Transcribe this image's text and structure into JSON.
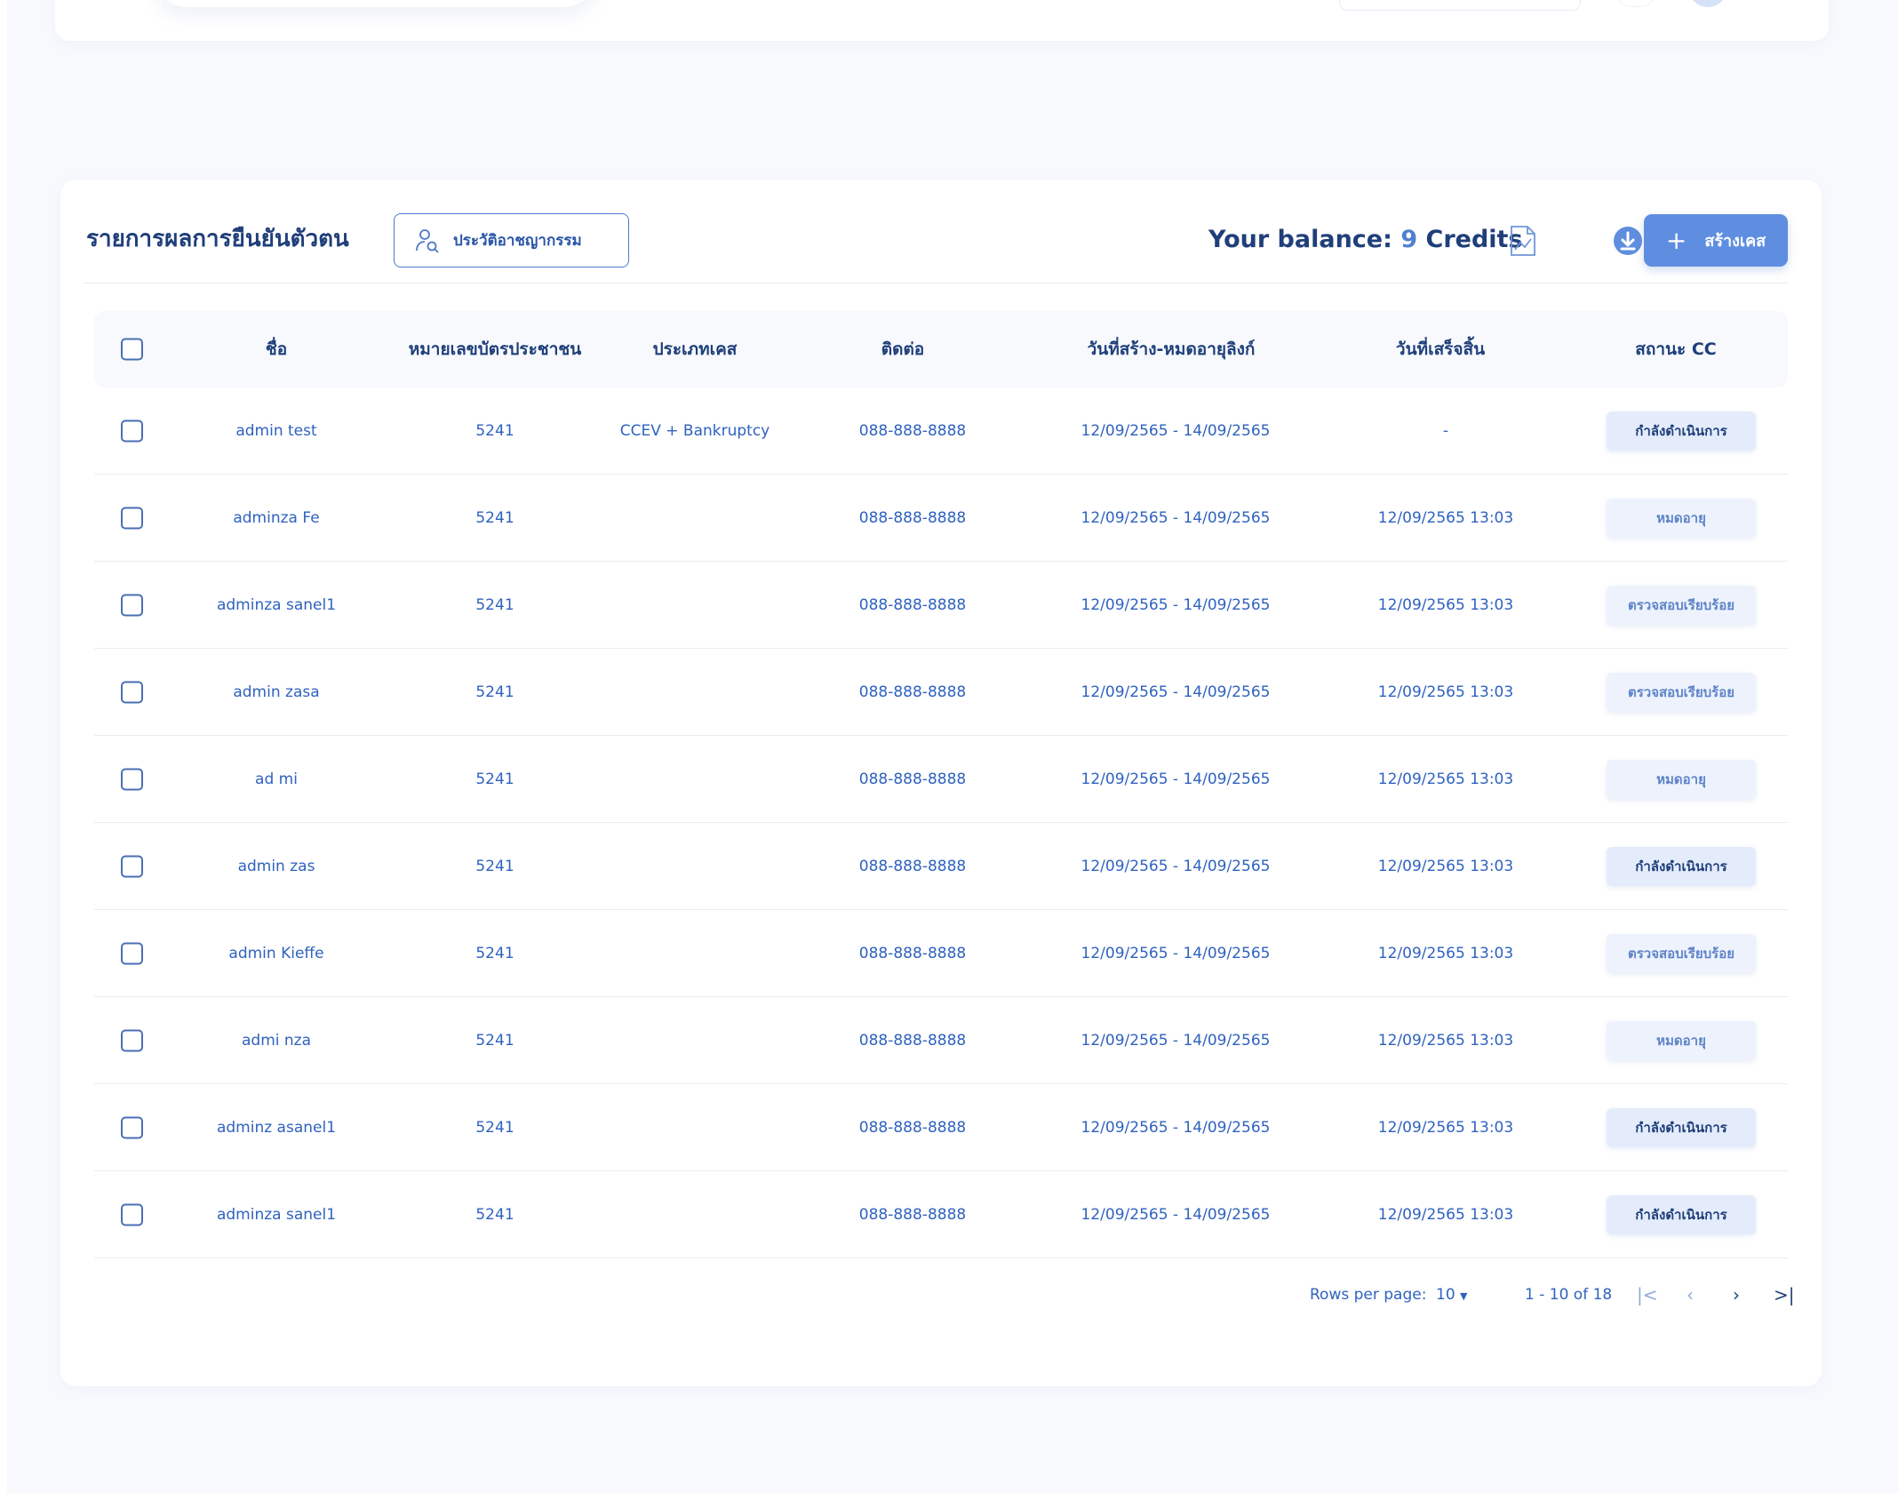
{
  "page": {
    "title": "รายการผลการยืนยันตัวตน",
    "history_button": "ประวัติอาชญากรรม",
    "balance_prefix": "Your balance:",
    "balance_amount": "9",
    "balance_suffix": "Credits",
    "create_button": "สร้างเคส",
    "create_icon": "+"
  },
  "colors": {
    "accent": "#5f8ee0",
    "heading": "#1f3f7a",
    "text": "#2f62bf"
  },
  "table": {
    "columns": [
      "ชื่อ",
      "หมายเลขบัตรประชาชน",
      "ประเภทเคส",
      "ติดต่อ",
      "วันที่สร้าง-หมดอายุลิงก์",
      "วันที่เสร็จสิ้น",
      "สถานะ CC"
    ],
    "rows": [
      {
        "name": "admin test",
        "id": "5241",
        "type": "CCEV + Bankruptcy",
        "contact": "088-888-8888",
        "dates": "12/09/2565 - 14/09/2565",
        "finished": "-",
        "status": "กำลังดำเนินการ",
        "status_kind": "progress"
      },
      {
        "name": "adminza Fe",
        "id": "5241",
        "type": "",
        "contact": "088-888-8888",
        "dates": "12/09/2565 - 14/09/2565",
        "finished": "12/09/2565 13:03",
        "status": "หมดอายุ",
        "status_kind": "expired"
      },
      {
        "name": "adminza sanel1",
        "id": "5241",
        "type": "",
        "contact": "088-888-8888",
        "dates": "12/09/2565 - 14/09/2565",
        "finished": "12/09/2565 13:03",
        "status": "ตรวจสอบเรียบร้อย",
        "status_kind": "verified"
      },
      {
        "name": "admin zasa",
        "id": "5241",
        "type": "",
        "contact": "088-888-8888",
        "dates": "12/09/2565 - 14/09/2565",
        "finished": "12/09/2565 13:03",
        "status": "ตรวจสอบเรียบร้อย",
        "status_kind": "verified"
      },
      {
        "name": "ad mi",
        "id": "5241",
        "type": "",
        "contact": "088-888-8888",
        "dates": "12/09/2565 - 14/09/2565",
        "finished": "12/09/2565 13:03",
        "status": "หมดอายุ",
        "status_kind": "expired"
      },
      {
        "name": "admin zas",
        "id": "5241",
        "type": "",
        "contact": "088-888-8888",
        "dates": "12/09/2565 - 14/09/2565",
        "finished": "12/09/2565 13:03",
        "status": "กำลังดำเนินการ",
        "status_kind": "progress"
      },
      {
        "name": "admin Kieffe",
        "id": "5241",
        "type": "",
        "contact": "088-888-8888",
        "dates": "12/09/2565 - 14/09/2565",
        "finished": "12/09/2565 13:03",
        "status": "ตรวจสอบเรียบร้อย",
        "status_kind": "verified"
      },
      {
        "name": "admi nza",
        "id": "5241",
        "type": "",
        "contact": "088-888-8888",
        "dates": "12/09/2565 - 14/09/2565",
        "finished": "12/09/2565 13:03",
        "status": "หมดอายุ",
        "status_kind": "expired"
      },
      {
        "name": "adminz asanel1",
        "id": "5241",
        "type": "",
        "contact": "088-888-8888",
        "dates": "12/09/2565 - 14/09/2565",
        "finished": "12/09/2565 13:03",
        "status": "กำลังดำเนินการ",
        "status_kind": "progress"
      },
      {
        "name": "adminza sanel1",
        "id": "5241",
        "type": "",
        "contact": "088-888-8888",
        "dates": "12/09/2565 - 14/09/2565",
        "finished": "12/09/2565 13:03",
        "status": "กำลังดำเนินการ",
        "status_kind": "progress"
      }
    ]
  },
  "pagination": {
    "rows_per_page_label": "Rows per page:",
    "rows_per_page_value": "10",
    "range": "1 - 10 of 18",
    "first": "|<",
    "prev": "‹",
    "next": "›",
    "last": ">|"
  }
}
